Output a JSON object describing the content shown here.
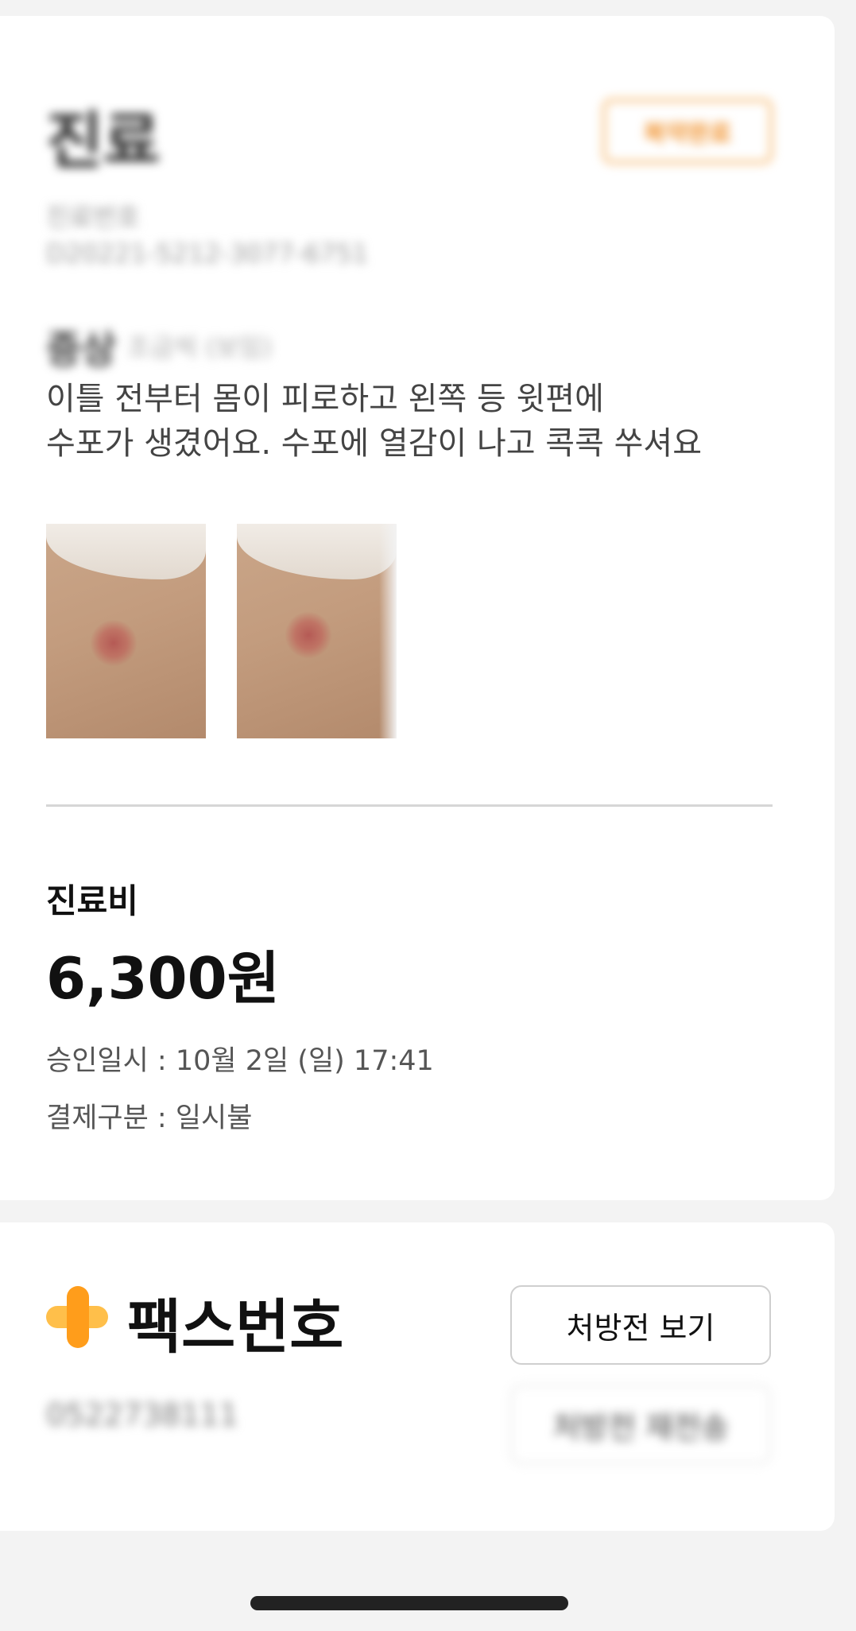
{
  "header": {
    "title": "진료",
    "status_button": "복약완료",
    "id_label": "진료번호",
    "id_value": "D20221-5212-3077-6751"
  },
  "symptom": {
    "title": "증상",
    "subtitle": "조금씩 (보임)",
    "text_line1": "이틀 전부터 몸이 피로하고 왼쪽 등 윗편에",
    "text_line2": "수포가 생겼어요. 수포에 열감이 나고 콕콕 쑤셔요"
  },
  "photos": [
    "rash-photo",
    "rash-photo"
  ],
  "fee": {
    "label": "진료비",
    "amount": "6,300원",
    "approved_at": "승인일시 : 10월 2일 (일) 17:41",
    "payment_type": "결제구분 : 일시불"
  },
  "pharmacy": {
    "fax_title": "팩스번호",
    "fax_number": "0522738111",
    "view_button": "처방전 보기",
    "resend_button": "처방전 재전송"
  },
  "colors": {
    "accent": "#ff9d1b",
    "accent_light": "#ffbf4a",
    "status_border": "#f6b66a"
  }
}
